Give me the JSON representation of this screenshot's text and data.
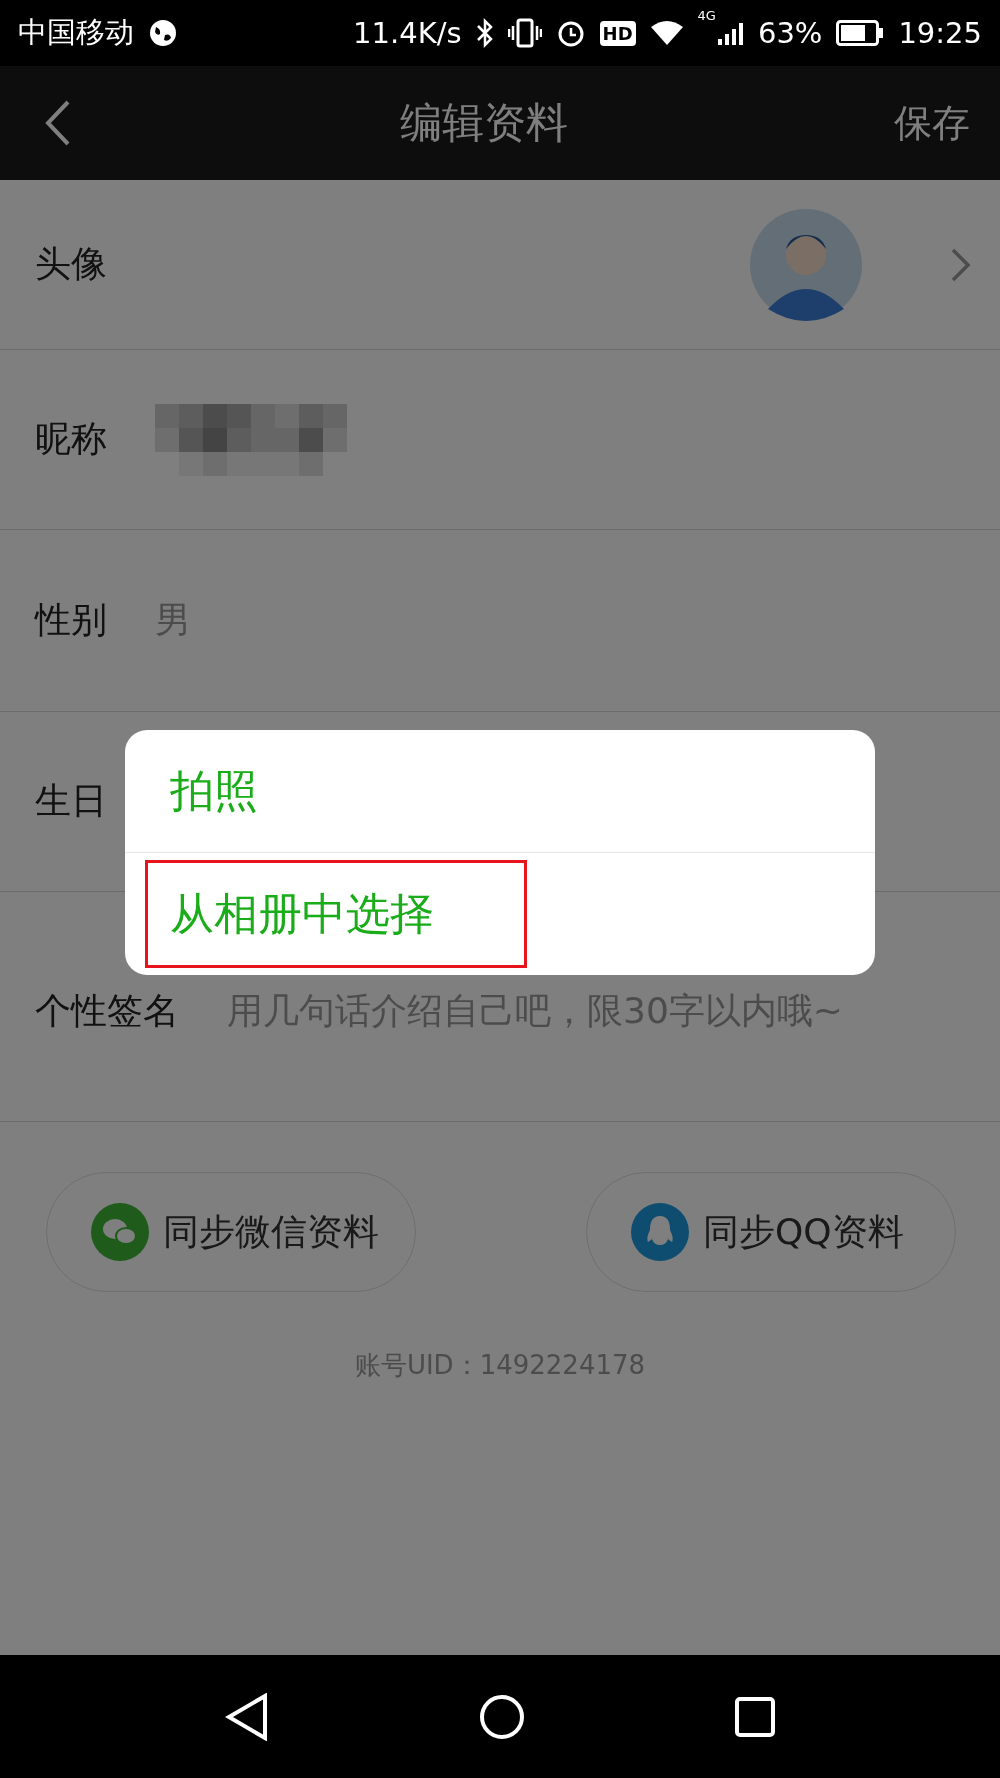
{
  "status_bar": {
    "carrier": "中国移动",
    "speed": "11.4K/s",
    "hd": "HD",
    "network": "4G",
    "battery": "63%",
    "time": "19:25"
  },
  "header": {
    "title": "编辑资料",
    "save": "保存"
  },
  "rows": [
    {
      "kind": "avatar",
      "label": "头像"
    },
    {
      "kind": "mosaic",
      "label": "昵称"
    },
    {
      "kind": "text",
      "label": "性别",
      "value": "男"
    },
    {
      "kind": "text",
      "label": "生日"
    },
    {
      "kind": "signature",
      "label": "个性签名",
      "value": "用几句话介绍自己吧，限30字以内哦~"
    }
  ],
  "sync_buttons": [
    {
      "kind": "wechat",
      "label": "同步微信资料"
    },
    {
      "kind": "qq",
      "label": "同步QQ资料"
    }
  ],
  "uid": "账号UID：1492224178",
  "dialog": {
    "items": [
      {
        "label": "拍照",
        "highlighted": false
      },
      {
        "label": "从相册中选择",
        "highlighted": true
      }
    ]
  }
}
